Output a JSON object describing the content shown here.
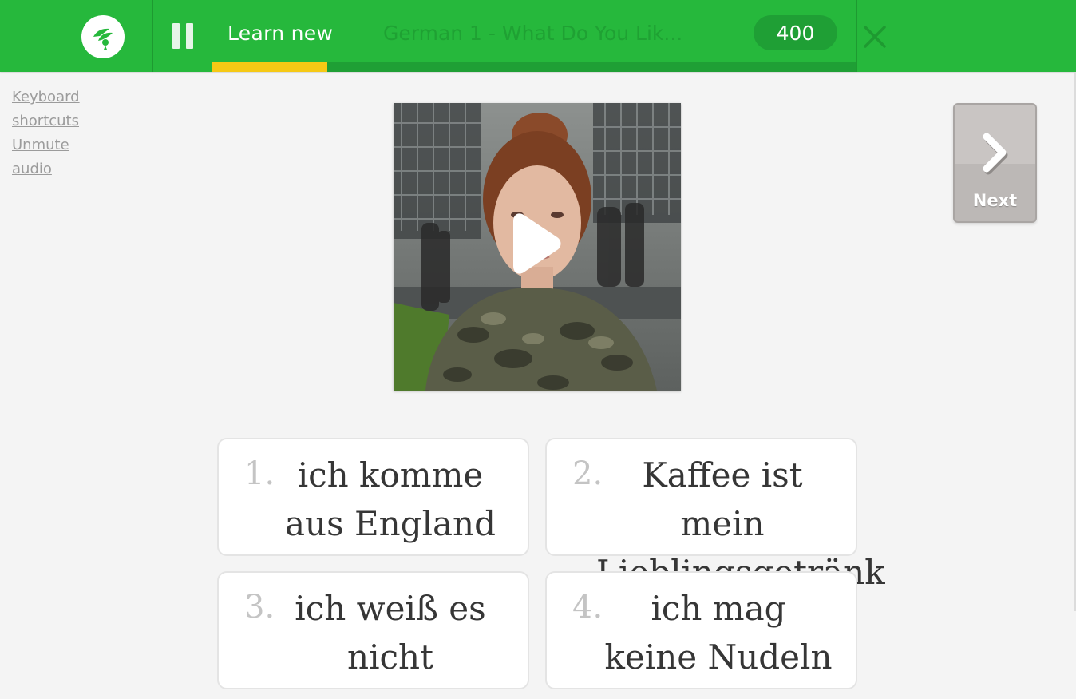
{
  "header": {
    "mode_label": "Learn new",
    "course_title": "German 1 - What Do You Lik...",
    "points": "400",
    "progress_fraction": 0.18
  },
  "side_links": [
    "Keyboard",
    "shortcuts",
    "Unmute",
    "audio"
  ],
  "next_button": {
    "label": "Next"
  },
  "answers": [
    {
      "number": "1.",
      "text": "ich komme aus England"
    },
    {
      "number": "2.",
      "text": "Kaffee ist mein Lieblingsgetränk"
    },
    {
      "number": "3.",
      "text": "ich weiß es nicht"
    },
    {
      "number": "4.",
      "text": "ich mag keine Nudeln"
    }
  ],
  "icons": {
    "logo": "memrise-flower-icon",
    "pause": "pause-icon",
    "close": "close-icon",
    "play": "play-icon",
    "next": "chevron-right-icon"
  },
  "colors": {
    "header_green": "#26b83c",
    "progress_yellow": "#f6c915",
    "badge_green": "#1f9f35"
  }
}
